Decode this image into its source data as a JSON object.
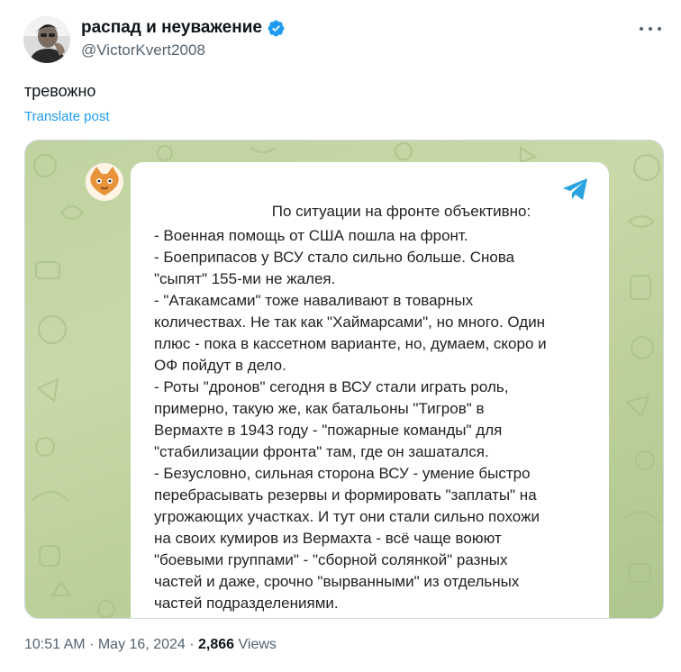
{
  "author": {
    "display_name": "распад и неуважение",
    "handle": "@VictorKvert2008",
    "verified": true
  },
  "tweet": {
    "text": "тревожно",
    "translate_label": "Translate post"
  },
  "media": {
    "message_title": "По ситуации на фронте объективно:",
    "message_lines": [
      "- Военная помощь от США пошла на фронт.",
      "- Боеприпасов у ВСУ стало сильно больше. Снова",
      "\"сыпят\" 155-ми не жалея.",
      "- \"Атакамсами\" тоже наваливают в товарных",
      "количествах. Не так как \"Хаймарсами\", но много. Один",
      "плюс - пока в кассетном варианте, но, думаем, скоро и",
      "ОФ пойдут в дело.",
      "- Роты \"дронов\" сегодня в ВСУ стали играть роль,",
      "примерно, такую же, как батальоны \"Тигров\" в",
      "Вермахте в 1943 году - \"пожарные команды\" для",
      "\"стабилизации фронта\" там, где он зашатался.",
      "- Безусловно, сильная сторона ВСУ - умение быстро",
      "перебрасывать резервы и формировать \"заплаты\" на",
      "угрожающих участках. И тут они стали сильно похожи",
      "на своих кумиров из Вермахта - всё чаще воюют",
      "\"боевыми группами\" - \"сборной солянкой\" разных",
      "частей и даже, срочно \"вырванными\" из отдельных",
      "частей подразделениями."
    ]
  },
  "footer": {
    "time": "10:51 AM",
    "separator": "·",
    "date": "May 16, 2024",
    "views_count": "2,866",
    "views_label": "Views"
  },
  "icons": {
    "verified": "verified-badge-icon",
    "more": "more-options-icon",
    "telegram": "telegram-logo-icon"
  },
  "colors": {
    "link": "#1d9bf0",
    "verified": "#1d9bf0",
    "telegram": "#2aa3df",
    "secondary_text": "#536471",
    "media_bg": "#c2d5a0"
  }
}
